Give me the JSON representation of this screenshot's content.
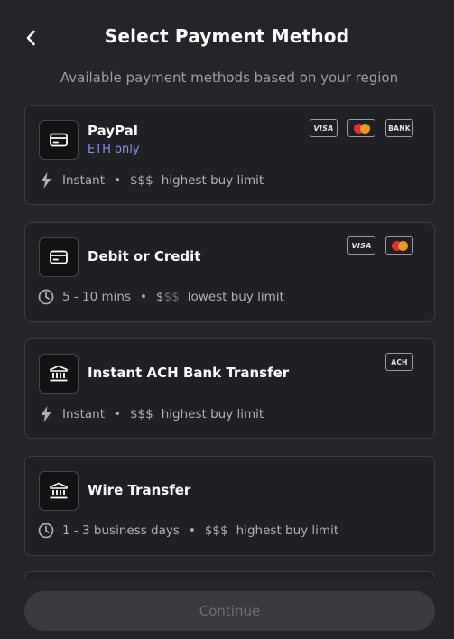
{
  "header": {
    "title": "Select Payment Method",
    "subtitle": "Available payment methods based on your region",
    "back_icon": "chevron-left-icon"
  },
  "methods": [
    {
      "name": "PayPal",
      "note": "ETH only",
      "icon": "card-icon",
      "badges": [
        "VISA",
        "mastercard",
        "BANK"
      ],
      "speed_icon": "lightning-icon",
      "speed": "Instant",
      "price_on": "$$$",
      "price_off": "",
      "limit": "highest buy limit"
    },
    {
      "name": "Debit or Credit",
      "note": "",
      "icon": "card-icon",
      "badges": [
        "VISA",
        "mastercard"
      ],
      "speed_icon": "clock-icon",
      "speed": "5 - 10 mins",
      "price_on": "$",
      "price_off": "$$",
      "limit": "lowest buy limit"
    },
    {
      "name": "Instant ACH Bank Transfer",
      "note": "",
      "icon": "bank-icon",
      "badges": [
        "ACH"
      ],
      "speed_icon": "lightning-icon",
      "speed": "Instant",
      "price_on": "$$$",
      "price_off": "",
      "limit": "highest buy limit"
    },
    {
      "name": "Wire Transfer",
      "note": "",
      "icon": "bank-icon",
      "badges": [],
      "speed_icon": "clock-icon",
      "speed": "1 - 3 business days",
      "price_on": "$$$",
      "price_off": "",
      "limit": "highest buy limit"
    }
  ],
  "footer": {
    "continue_label": "Continue"
  },
  "colors": {
    "background": "#242529",
    "card": "#1f2024",
    "accent_note": "#8f8cf0",
    "button_disabled": "#3a3b41"
  }
}
